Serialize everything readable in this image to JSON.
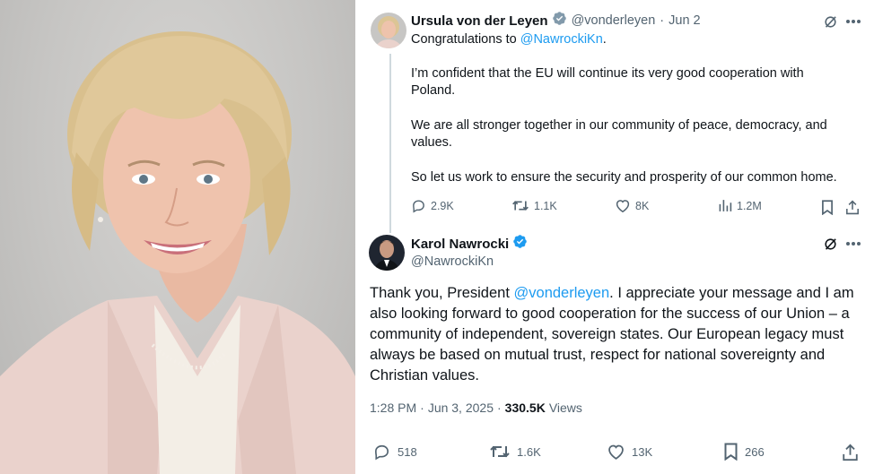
{
  "tweet1": {
    "author_name": "Ursula von der Leyen",
    "handle": "@vonderleyen",
    "separator": "·",
    "date": "Jun 2",
    "intro_text": "Congratulations to",
    "mention": "@NawrockiKn",
    "intro_end": ".",
    "paragraphs": [
      "I’m confident that the EU will continue its very good cooperation with Poland.",
      "We are all stronger together in our community of peace, democracy, and values.",
      "So let us work to ensure the security and prosperity of our common home."
    ],
    "replies": "2.9K",
    "reposts": "1.1K",
    "likes": "8K",
    "views": "1.2M",
    "verified_badge_color": "#829aab"
  },
  "tweet2": {
    "author_name": "Karol Nawrocki",
    "handle": "@NawrockiKn",
    "verified_badge_color": "#1d9bf0",
    "text_before": "Thank you, President ",
    "mention": "@vonderleyen",
    "text_after": ". I appreciate your message and I am also looking forward to good cooperation for the success of our Union – a community of independent, sovereign states. Our European legacy must always be based on mutual trust, respect for national sovereignty and Christian values.",
    "time": "1:28 PM",
    "separator": "·",
    "date": "Jun 3, 2025",
    "separator2": "·",
    "view_count": "330.5K",
    "views_label": "Views",
    "replies": "518",
    "reposts": "1.6K",
    "likes": "13K",
    "bookmarks": "266"
  },
  "colors": {
    "accent": "#1d9bf0",
    "text": "#0f1419",
    "muted": "#536471"
  }
}
